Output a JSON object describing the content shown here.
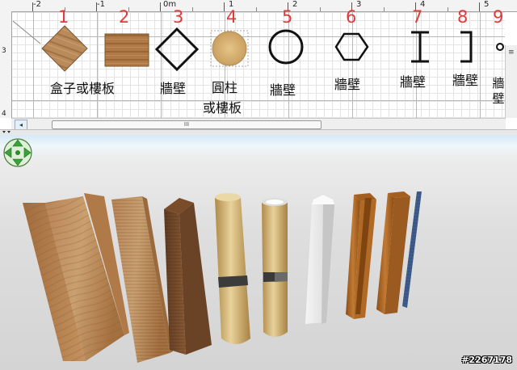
{
  "plan": {
    "ruler_top": [
      "-2",
      "-1",
      "0m",
      "1",
      "2",
      "3",
      "4",
      "5"
    ],
    "ruler_left": [
      "3",
      "4"
    ],
    "items": [
      {
        "number": "1",
        "label": "盒子或樓板"
      },
      {
        "number": "2",
        "label": ""
      },
      {
        "number": "3",
        "label": "牆壁"
      },
      {
        "number": "4",
        "label_line1": "圓柱",
        "label_line2": "或樓板"
      },
      {
        "number": "5",
        "label": "牆壁"
      },
      {
        "number": "6",
        "label": "牆壁"
      },
      {
        "number": "7",
        "label": "牆壁"
      },
      {
        "number": "8",
        "label": "牆壁"
      },
      {
        "number": "9",
        "label": "牆壁"
      }
    ],
    "scroll_thumb": "III",
    "scroll_left_arrow": "◂"
  },
  "view3d": {
    "watermark": "#2267178"
  },
  "colors": {
    "item_number": "#e03a3a",
    "grid_major": "#b8b8b8",
    "grid_minor": "#e4e4e4",
    "wood_light": "#c8955f",
    "wood_dark": "#6b4328",
    "wall_white": "#e8e8e8",
    "steel_beam": "#a8641e",
    "blue_bar": "#3f5d8c"
  }
}
